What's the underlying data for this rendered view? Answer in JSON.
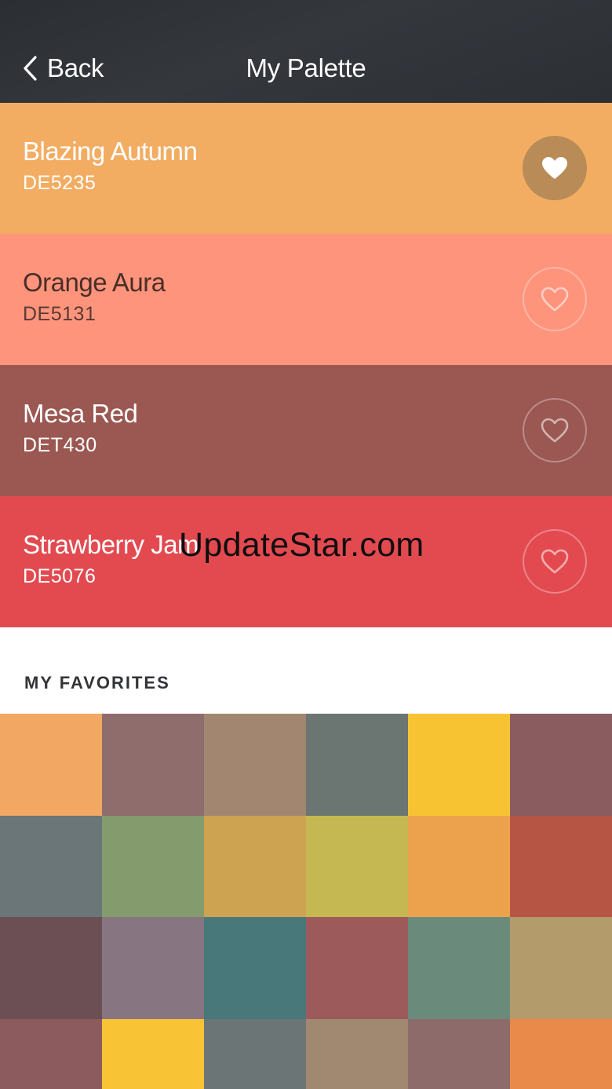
{
  "nav": {
    "back_label": "Back",
    "title": "My Palette"
  },
  "palette": [
    {
      "name": "Blazing Autumn",
      "code": "DE5235",
      "color": "#f2ad63",
      "text_color": "#ffffff",
      "code_color": "#ffffff",
      "favorited": true
    },
    {
      "name": "Orange Aura",
      "code": "DE5131",
      "color": "#fe947c",
      "text_color": "#4a2e28",
      "code_color": "#5a3a32",
      "favorited": false
    },
    {
      "name": "Mesa Red",
      "code": "DET430",
      "color": "#9b5751",
      "text_color": "#ffffff",
      "code_color": "#ffffff",
      "favorited": false
    },
    {
      "name": "Strawberry Jam",
      "code": "DE5076",
      "color": "#e24a50",
      "text_color": "#ffffff",
      "code_color": "#ffffff",
      "favorited": false
    }
  ],
  "watermark": "UpdateStar.com",
  "favorites": {
    "heading": "MY FAVORITES",
    "swatches": [
      "#f2a862",
      "#8e6d6c",
      "#a28670",
      "#6b7572",
      "#f8c332",
      "#8a5c5f",
      "#6a7677",
      "#849c6d",
      "#cda351",
      "#c5b752",
      "#eca24c",
      "#b65544",
      "#6b4f55",
      "#877582",
      "#48787a",
      "#9c5b5a",
      "#6a8b7b",
      "#b49b6c",
      "#8b5b5d",
      "#f8c334",
      "#6b7575",
      "#a18871",
      "#8e6b6b",
      "#e98a4b"
    ]
  },
  "icons": {
    "back": "chevron-left-icon",
    "favorite_on": "heart-filled-icon",
    "favorite_off": "heart-outline-icon"
  }
}
